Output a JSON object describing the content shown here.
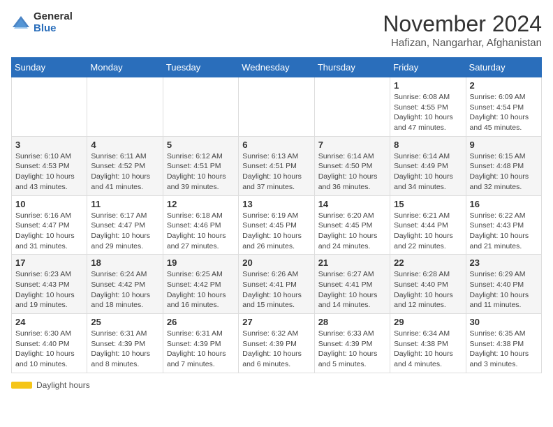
{
  "logo": {
    "general": "General",
    "blue": "Blue"
  },
  "title": "November 2024",
  "location": "Hafizan, Nangarhar, Afghanistan",
  "days_header": [
    "Sunday",
    "Monday",
    "Tuesday",
    "Wednesday",
    "Thursday",
    "Friday",
    "Saturday"
  ],
  "weeks": [
    [
      {
        "day": "",
        "info": ""
      },
      {
        "day": "",
        "info": ""
      },
      {
        "day": "",
        "info": ""
      },
      {
        "day": "",
        "info": ""
      },
      {
        "day": "",
        "info": ""
      },
      {
        "day": "1",
        "info": "Sunrise: 6:08 AM\nSunset: 4:55 PM\nDaylight: 10 hours and 47 minutes."
      },
      {
        "day": "2",
        "info": "Sunrise: 6:09 AM\nSunset: 4:54 PM\nDaylight: 10 hours and 45 minutes."
      }
    ],
    [
      {
        "day": "3",
        "info": "Sunrise: 6:10 AM\nSunset: 4:53 PM\nDaylight: 10 hours and 43 minutes."
      },
      {
        "day": "4",
        "info": "Sunrise: 6:11 AM\nSunset: 4:52 PM\nDaylight: 10 hours and 41 minutes."
      },
      {
        "day": "5",
        "info": "Sunrise: 6:12 AM\nSunset: 4:51 PM\nDaylight: 10 hours and 39 minutes."
      },
      {
        "day": "6",
        "info": "Sunrise: 6:13 AM\nSunset: 4:51 PM\nDaylight: 10 hours and 37 minutes."
      },
      {
        "day": "7",
        "info": "Sunrise: 6:14 AM\nSunset: 4:50 PM\nDaylight: 10 hours and 36 minutes."
      },
      {
        "day": "8",
        "info": "Sunrise: 6:14 AM\nSunset: 4:49 PM\nDaylight: 10 hours and 34 minutes."
      },
      {
        "day": "9",
        "info": "Sunrise: 6:15 AM\nSunset: 4:48 PM\nDaylight: 10 hours and 32 minutes."
      }
    ],
    [
      {
        "day": "10",
        "info": "Sunrise: 6:16 AM\nSunset: 4:47 PM\nDaylight: 10 hours and 31 minutes."
      },
      {
        "day": "11",
        "info": "Sunrise: 6:17 AM\nSunset: 4:47 PM\nDaylight: 10 hours and 29 minutes."
      },
      {
        "day": "12",
        "info": "Sunrise: 6:18 AM\nSunset: 4:46 PM\nDaylight: 10 hours and 27 minutes."
      },
      {
        "day": "13",
        "info": "Sunrise: 6:19 AM\nSunset: 4:45 PM\nDaylight: 10 hours and 26 minutes."
      },
      {
        "day": "14",
        "info": "Sunrise: 6:20 AM\nSunset: 4:45 PM\nDaylight: 10 hours and 24 minutes."
      },
      {
        "day": "15",
        "info": "Sunrise: 6:21 AM\nSunset: 4:44 PM\nDaylight: 10 hours and 22 minutes."
      },
      {
        "day": "16",
        "info": "Sunrise: 6:22 AM\nSunset: 4:43 PM\nDaylight: 10 hours and 21 minutes."
      }
    ],
    [
      {
        "day": "17",
        "info": "Sunrise: 6:23 AM\nSunset: 4:43 PM\nDaylight: 10 hours and 19 minutes."
      },
      {
        "day": "18",
        "info": "Sunrise: 6:24 AM\nSunset: 4:42 PM\nDaylight: 10 hours and 18 minutes."
      },
      {
        "day": "19",
        "info": "Sunrise: 6:25 AM\nSunset: 4:42 PM\nDaylight: 10 hours and 16 minutes."
      },
      {
        "day": "20",
        "info": "Sunrise: 6:26 AM\nSunset: 4:41 PM\nDaylight: 10 hours and 15 minutes."
      },
      {
        "day": "21",
        "info": "Sunrise: 6:27 AM\nSunset: 4:41 PM\nDaylight: 10 hours and 14 minutes."
      },
      {
        "day": "22",
        "info": "Sunrise: 6:28 AM\nSunset: 4:40 PM\nDaylight: 10 hours and 12 minutes."
      },
      {
        "day": "23",
        "info": "Sunrise: 6:29 AM\nSunset: 4:40 PM\nDaylight: 10 hours and 11 minutes."
      }
    ],
    [
      {
        "day": "24",
        "info": "Sunrise: 6:30 AM\nSunset: 4:40 PM\nDaylight: 10 hours and 10 minutes."
      },
      {
        "day": "25",
        "info": "Sunrise: 6:31 AM\nSunset: 4:39 PM\nDaylight: 10 hours and 8 minutes."
      },
      {
        "day": "26",
        "info": "Sunrise: 6:31 AM\nSunset: 4:39 PM\nDaylight: 10 hours and 7 minutes."
      },
      {
        "day": "27",
        "info": "Sunrise: 6:32 AM\nSunset: 4:39 PM\nDaylight: 10 hours and 6 minutes."
      },
      {
        "day": "28",
        "info": "Sunrise: 6:33 AM\nSunset: 4:39 PM\nDaylight: 10 hours and 5 minutes."
      },
      {
        "day": "29",
        "info": "Sunrise: 6:34 AM\nSunset: 4:38 PM\nDaylight: 10 hours and 4 minutes."
      },
      {
        "day": "30",
        "info": "Sunrise: 6:35 AM\nSunset: 4:38 PM\nDaylight: 10 hours and 3 minutes."
      }
    ]
  ],
  "footer": {
    "label": "Daylight hours"
  }
}
